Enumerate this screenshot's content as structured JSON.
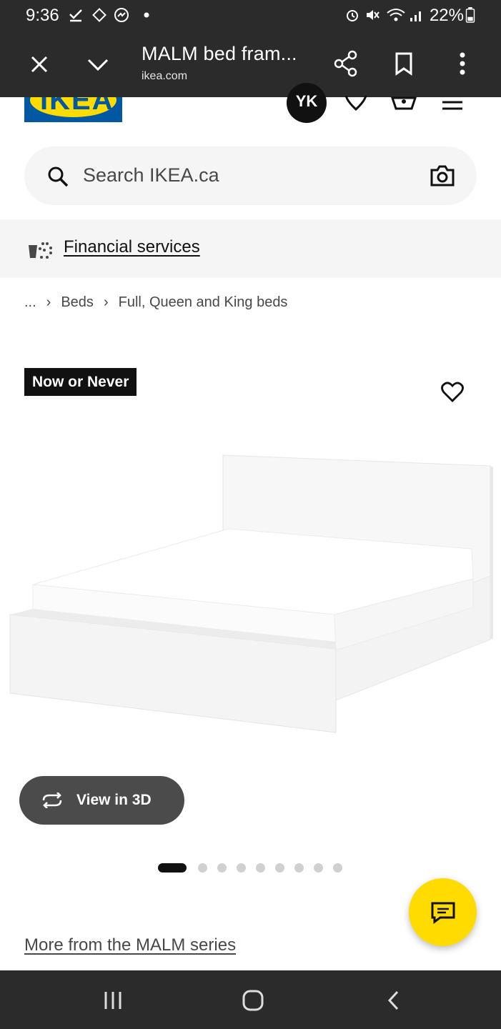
{
  "status_bar": {
    "time": "9:36",
    "battery": "22%",
    "left_icons": [
      "check-icon",
      "pinwheel-icon",
      "messenger-icon",
      "dot-icon"
    ],
    "right_icons": [
      "alarm-icon",
      "mute-icon",
      "wifi-icon",
      "signal-icon",
      "battery-icon"
    ]
  },
  "browser": {
    "title": "MALM bed fram...",
    "url": "ikea.com",
    "icons": [
      "close-icon",
      "chevron-down-icon",
      "share-icon",
      "bookmark-icon",
      "more-vert-icon"
    ]
  },
  "header": {
    "logo_text": "IKEA",
    "avatar_initials": "YK",
    "icons": [
      "heart-icon",
      "cart-icon",
      "menu-icon"
    ]
  },
  "search": {
    "placeholder": "Search IKEA.ca"
  },
  "financial": {
    "label": "Financial services"
  },
  "breadcrumb": {
    "ellipsis": "...",
    "items": [
      "Beds",
      "Full, Queen and King beds"
    ]
  },
  "product": {
    "badge": "Now or Never",
    "view3d_label": "View in 3D",
    "carousel_count": 9,
    "carousel_active": 1
  },
  "series_link": "More from the MALM series",
  "colors": {
    "ikea_blue": "#0058a3",
    "ikea_yellow": "#ffdb00",
    "dark_bar": "#2b2b2b"
  }
}
